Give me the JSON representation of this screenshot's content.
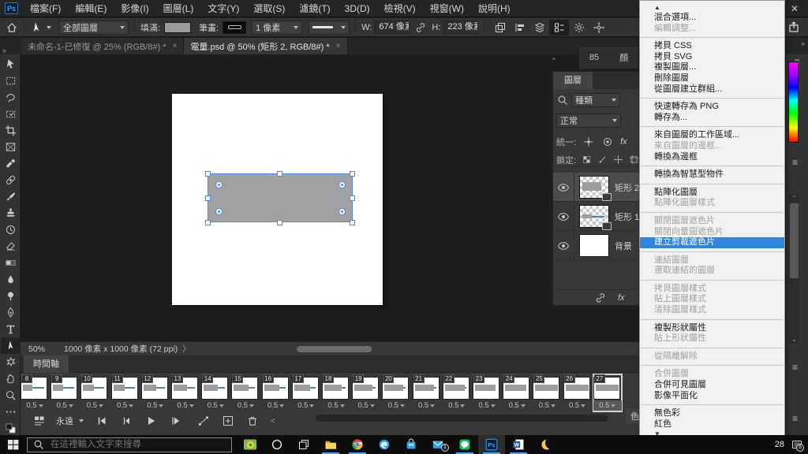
{
  "app": {
    "close_label": "✕",
    "collapse_chevrons": "»",
    "dock_tab_number": "85",
    "dock_tab_color": "顏"
  },
  "menu_bar": {
    "items": [
      "檔案(F)",
      "編輯(E)",
      "影像(I)",
      "圖層(L)",
      "文字(Y)",
      "選取(S)",
      "濾鏡(T)",
      "3D(D)",
      "檢視(V)",
      "視窗(W)",
      "說明(H)"
    ]
  },
  "options_bar": {
    "tool_scope": "全部圖層",
    "fill_label": "填滿:",
    "stroke_label": "筆畫:",
    "stroke_width": "1 像素",
    "w_label": "W:",
    "w_value": "674 像素",
    "h_label": "H:",
    "h_value": "223 像素"
  },
  "document_tabs": [
    {
      "title": "未命名-1-已修復 @ 25% (RGB/8#) *",
      "close": "×",
      "active": false
    },
    {
      "title": "電量.psd @ 50% (矩形 2, RGB/8#) *",
      "close": "×",
      "active": true
    }
  ],
  "tools": [
    {
      "name": "move-tool",
      "icon": "move"
    },
    {
      "name": "marquee-tool",
      "icon": "marquee"
    },
    {
      "name": "lasso-tool",
      "icon": "lasso"
    },
    {
      "name": "object-selection-tool",
      "icon": "objsel"
    },
    {
      "name": "crop-tool",
      "icon": "crop"
    },
    {
      "name": "frame-tool",
      "icon": "frame"
    },
    {
      "name": "eyedropper-tool",
      "icon": "eyedropper"
    },
    {
      "name": "healing-brush-tool",
      "icon": "healing"
    },
    {
      "name": "brush-tool",
      "icon": "brush"
    },
    {
      "name": "clone-stamp-tool",
      "icon": "stamp"
    },
    {
      "name": "history-brush-tool",
      "icon": "history"
    },
    {
      "name": "eraser-tool",
      "icon": "eraser"
    },
    {
      "name": "gradient-tool",
      "icon": "gradient"
    },
    {
      "name": "blur-tool",
      "icon": "blur"
    },
    {
      "name": "dodge-tool",
      "icon": "dodge"
    },
    {
      "name": "pen-tool",
      "icon": "pen"
    },
    {
      "name": "type-tool",
      "icon": "type"
    },
    {
      "name": "path-selection-tool",
      "icon": "pathsel",
      "selected": true
    },
    {
      "name": "shape-tool",
      "icon": "shape"
    },
    {
      "name": "hand-tool",
      "icon": "hand"
    },
    {
      "name": "zoom-tool",
      "icon": "zoomt"
    },
    {
      "name": "edit-toolbar",
      "icon": "ellipsis"
    },
    {
      "name": "color-swatches",
      "icon": "swatches"
    }
  ],
  "status_bar": {
    "zoom_level": "50%",
    "doc_info": "1000 像素 x 1000 像素 (72 ppi)",
    "arrow": "〉"
  },
  "timeline": {
    "tab_label": "時間軸",
    "loop_label": "永遠",
    "frame_duration": "0.5",
    "frames": [
      8,
      9,
      10,
      11,
      12,
      13,
      14,
      15,
      16,
      17,
      18,
      19,
      20,
      21,
      22,
      23,
      24,
      25,
      26,
      27
    ],
    "selected_frame": 27,
    "peek_tab_label": "色"
  },
  "layers_panel": {
    "tab_label": "圖層",
    "filter_label": "種類",
    "blend_mode": "正常",
    "unify_label": "統一:",
    "lock_label": "鎖定:",
    "fx_label": "fx",
    "layers": [
      {
        "name": "矩形 2",
        "selected": true,
        "kind": "shape-wide"
      },
      {
        "name": "矩形 1",
        "selected": false,
        "kind": "shape-bar"
      },
      {
        "name": "背景",
        "selected": false,
        "kind": "background"
      }
    ]
  },
  "context_menu": {
    "items": [
      {
        "type": "scroll",
        "glyph": "▲"
      },
      {
        "label": "混合選項...",
        "state": "normal"
      },
      {
        "label": "編輯調整...",
        "state": "disabled"
      },
      {
        "type": "sep"
      },
      {
        "label": "拷貝 CSS",
        "state": "normal"
      },
      {
        "label": "拷貝 SVG",
        "state": "normal"
      },
      {
        "label": "複製圖層...",
        "state": "normal"
      },
      {
        "label": "刪除圖層",
        "state": "normal"
      },
      {
        "label": "從圖層建立群組...",
        "state": "normal"
      },
      {
        "type": "sep"
      },
      {
        "label": "快速轉存為 PNG",
        "state": "normal"
      },
      {
        "label": "轉存為...",
        "state": "normal"
      },
      {
        "type": "sep"
      },
      {
        "label": "來自圖層的工作區域...",
        "state": "normal"
      },
      {
        "label": "來自圖層的邊框...",
        "state": "disabled"
      },
      {
        "label": "轉換為邊框",
        "state": "normal"
      },
      {
        "type": "sep"
      },
      {
        "label": "轉換為智慧型物件",
        "state": "normal"
      },
      {
        "type": "sep"
      },
      {
        "label": "點陣化圖層",
        "state": "normal"
      },
      {
        "label": "點陣化圖層樣式",
        "state": "disabled"
      },
      {
        "type": "sep"
      },
      {
        "label": "關閉圖層遮色片",
        "state": "disabled"
      },
      {
        "label": "關閉向量圖遮色片",
        "state": "disabled"
      },
      {
        "label": "建立剪裁遮色片",
        "state": "highlight"
      },
      {
        "type": "sep"
      },
      {
        "label": "連結圖層",
        "state": "disabled"
      },
      {
        "label": "選取連結的圖層",
        "state": "disabled"
      },
      {
        "type": "sep"
      },
      {
        "label": "拷貝圖層樣式",
        "state": "disabled"
      },
      {
        "label": "貼上圖層樣式",
        "state": "disabled"
      },
      {
        "label": "清除圖層樣式",
        "state": "disabled"
      },
      {
        "type": "sep"
      },
      {
        "label": "複製形狀屬性",
        "state": "normal"
      },
      {
        "label": "貼上形狀屬性",
        "state": "disabled"
      },
      {
        "type": "sep"
      },
      {
        "label": "從隔離解除",
        "state": "disabled"
      },
      {
        "type": "sep"
      },
      {
        "label": "合併圖層",
        "state": "disabled"
      },
      {
        "label": "合併可見圖層",
        "state": "normal"
      },
      {
        "label": "影像平面化",
        "state": "normal"
      },
      {
        "type": "sep"
      },
      {
        "label": "無色彩",
        "state": "normal"
      },
      {
        "label": "紅色",
        "state": "normal"
      },
      {
        "type": "scroll",
        "glyph": "▼"
      }
    ]
  },
  "taskbar": {
    "search_placeholder": "在這裡輸入文字來搜尋",
    "temperature": "28",
    "tray_badge": "5",
    "mail_badge": "1",
    "apps": [
      {
        "name": "widget",
        "icon": "widget"
      },
      {
        "name": "cortana-button",
        "icon": "cortana"
      },
      {
        "name": "task-view-button",
        "icon": "taskview"
      },
      {
        "name": "file-explorer",
        "icon": "folder",
        "running": true
      },
      {
        "name": "chrome",
        "icon": "chrome",
        "running": true
      },
      {
        "name": "edge",
        "icon": "edge"
      },
      {
        "name": "microsoft-store",
        "icon": "store"
      },
      {
        "name": "mail",
        "icon": "mail",
        "badge": "1"
      },
      {
        "name": "line",
        "icon": "line",
        "running": true
      },
      {
        "name": "photoshop",
        "icon": "ps",
        "running": true,
        "active": true
      },
      {
        "name": "word",
        "icon": "word",
        "running": true
      },
      {
        "name": "night-light",
        "icon": "moon"
      }
    ]
  },
  "colors": {
    "menu_highlight": "#2e86e0",
    "selection_blue": "#4a8ce8",
    "ps_blue": "#31a8ff",
    "rect_fill": "#a1a1a4"
  }
}
